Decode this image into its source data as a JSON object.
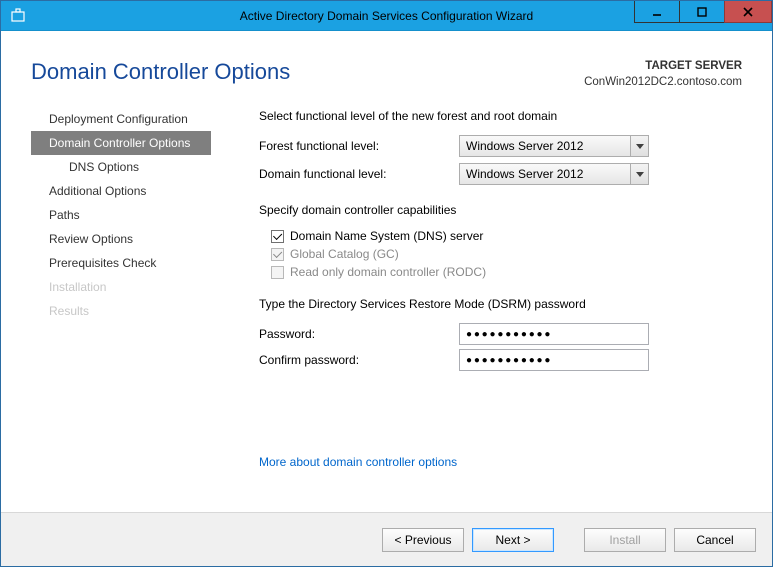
{
  "window": {
    "title": "Active Directory Domain Services Configuration Wizard"
  },
  "header": {
    "page_title": "Domain Controller Options",
    "target_label": "TARGET SERVER",
    "target_value": "ConWin2012DC2.contoso.com"
  },
  "sidebar": {
    "items": [
      {
        "label": "Deployment Configuration"
      },
      {
        "label": "Domain Controller Options"
      },
      {
        "label": "DNS Options"
      },
      {
        "label": "Additional Options"
      },
      {
        "label": "Paths"
      },
      {
        "label": "Review Options"
      },
      {
        "label": "Prerequisites Check"
      },
      {
        "label": "Installation"
      },
      {
        "label": "Results"
      }
    ]
  },
  "content": {
    "func_level_heading": "Select functional level of the new forest and root domain",
    "forest_label": "Forest functional level:",
    "forest_value": "Windows Server 2012",
    "domain_label": "Domain functional level:",
    "domain_value": "Windows Server 2012",
    "capabilities_heading": "Specify domain controller capabilities",
    "cb_dns": "Domain Name System (DNS) server",
    "cb_gc": "Global Catalog (GC)",
    "cb_rodc": "Read only domain controller (RODC)",
    "dsrm_heading": "Type the Directory Services Restore Mode (DSRM) password",
    "password_label": "Password:",
    "password_value": "●●●●●●●●●●●",
    "confirm_label": "Confirm password:",
    "confirm_value": "●●●●●●●●●●●",
    "help_link": "More about domain controller options"
  },
  "footer": {
    "previous": "< Previous",
    "next": "Next >",
    "install": "Install",
    "cancel": "Cancel"
  }
}
